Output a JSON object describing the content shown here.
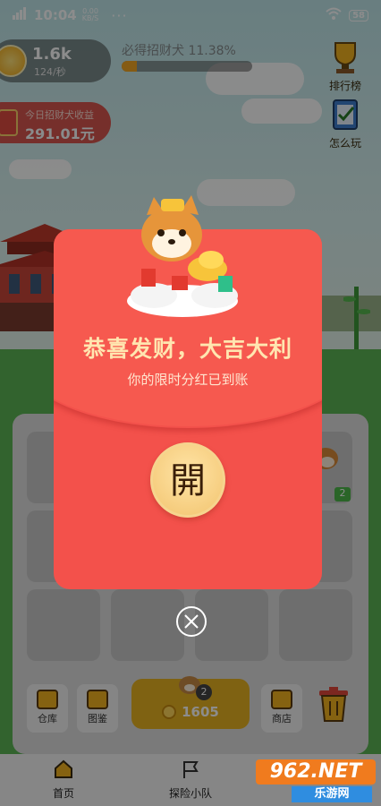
{
  "status_bar": {
    "time": "10:04",
    "net_speed_value": "0.00",
    "net_speed_unit": "KB/S",
    "more": "···",
    "battery": "58"
  },
  "hud": {
    "coins": "1.6k",
    "coin_rate": "124/秒",
    "progress_text": "必得招财犬 11.38%",
    "progress_fraction": 0.1138,
    "earnings_label": "今日招财犬收益",
    "earnings_value": "291.01元",
    "leaderboard_label": "排行榜",
    "howto_label": "怎么玩"
  },
  "board": {
    "level_badge": "2",
    "warehouse_label": "仓库",
    "catalog_label": "图鉴",
    "buy_count": "2",
    "buy_price": "1605",
    "shop_label": "商店"
  },
  "nav": {
    "home_label": "首页",
    "expedition_label": "探险小队"
  },
  "envelope": {
    "title": "恭喜发财，大吉大利",
    "subtitle": "你的限时分红已到账",
    "open_glyph": "開"
  },
  "watermark": {
    "brand": "962.NET",
    "tagline": "乐游网"
  },
  "colors": {
    "envelope_red": "#f3514b",
    "gold": "#f2c46f",
    "grass": "#5bb454"
  }
}
